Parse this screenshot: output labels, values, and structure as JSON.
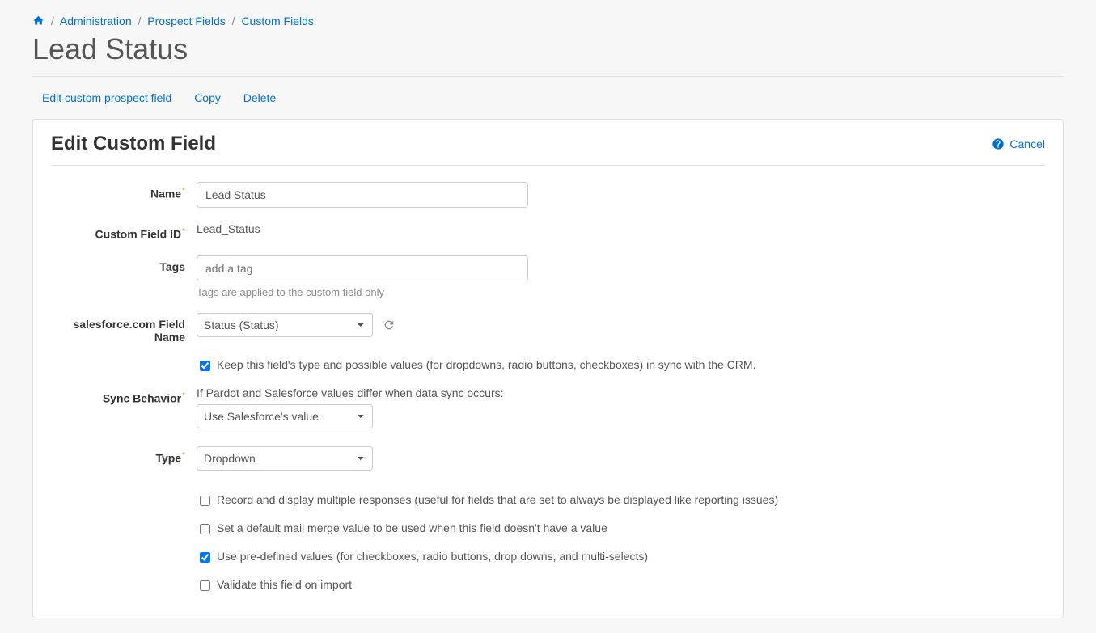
{
  "breadcrumb": {
    "admin": "Administration",
    "prospect_fields": "Prospect Fields",
    "custom_fields": "Custom Fields"
  },
  "page_title": "Lead Status",
  "actions": {
    "edit": "Edit custom prospect field",
    "copy": "Copy",
    "delete": "Delete"
  },
  "panel": {
    "title": "Edit Custom Field",
    "cancel": "Cancel"
  },
  "form": {
    "name_label": "Name",
    "name_value": "Lead Status",
    "custom_field_id_label": "Custom Field ID",
    "custom_field_id_value": "Lead_Status",
    "tags_label": "Tags",
    "tags_placeholder": "add a tag",
    "tags_help": "Tags are applied to the custom field only",
    "sf_field_label_1": "salesforce.com Field",
    "sf_field_label_2": "Name",
    "sf_field_value": "Status (Status)",
    "keep_sync_label": "Keep this field's type and possible values (for dropdowns, radio buttons, checkboxes) in sync with the CRM.",
    "sync_behavior_label": "Sync Behavior",
    "sync_behavior_desc": "If Pardot and Salesforce values differ when data sync occurs:",
    "sync_behavior_value": "Use Salesforce's value",
    "type_label": "Type",
    "type_value": "Dropdown",
    "cb_multiple": "Record and display multiple responses (useful for fields that are set to always be displayed like reporting issues)",
    "cb_default_merge": "Set a default mail merge value to be used when this field doesn't have a value",
    "cb_predefined": "Use pre-defined values (for checkboxes, radio buttons, drop downs, and multi-selects)",
    "cb_validate": "Validate this field on import"
  }
}
